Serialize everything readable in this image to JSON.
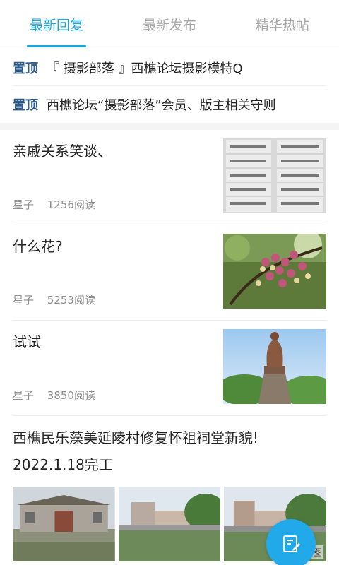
{
  "tabs": [
    {
      "label": "最新回复",
      "active": true
    },
    {
      "label": "最新发布",
      "active": false
    },
    {
      "label": "精华热帖",
      "active": false
    }
  ],
  "pinned": [
    {
      "tag": "置顶",
      "text": "『 摄影部落 』西樵论坛摄影模特Q"
    },
    {
      "tag": "置顶",
      "text": "西樵论坛“摄影部落”会员、版主相关守则"
    }
  ],
  "posts": [
    {
      "title": "亲戚关系笑谈、",
      "author": "星子",
      "reads": "1256阅读",
      "thumb": "text-table-image"
    },
    {
      "title": "什么花?",
      "author": "星子",
      "reads": "5253阅读",
      "thumb": "flower-image"
    },
    {
      "title": "试试",
      "author": "星子",
      "reads": "3850阅读",
      "thumb": "statue-image"
    }
  ],
  "big_post": {
    "title_line1": "西樵民乐藻美延陵村修复怀祖祠堂新貌!",
    "title_line2": "2022.1.18完工",
    "images": [
      "ancestral-hall-image",
      "pond-building-image",
      "pond-building-image-2"
    ],
    "image_count_label": "图"
  },
  "fab": {
    "icon": "compose-icon"
  },
  "colors": {
    "accent": "#19a4dc",
    "pin_tag": "#2d5b8a",
    "fab": "#22a9ea"
  }
}
